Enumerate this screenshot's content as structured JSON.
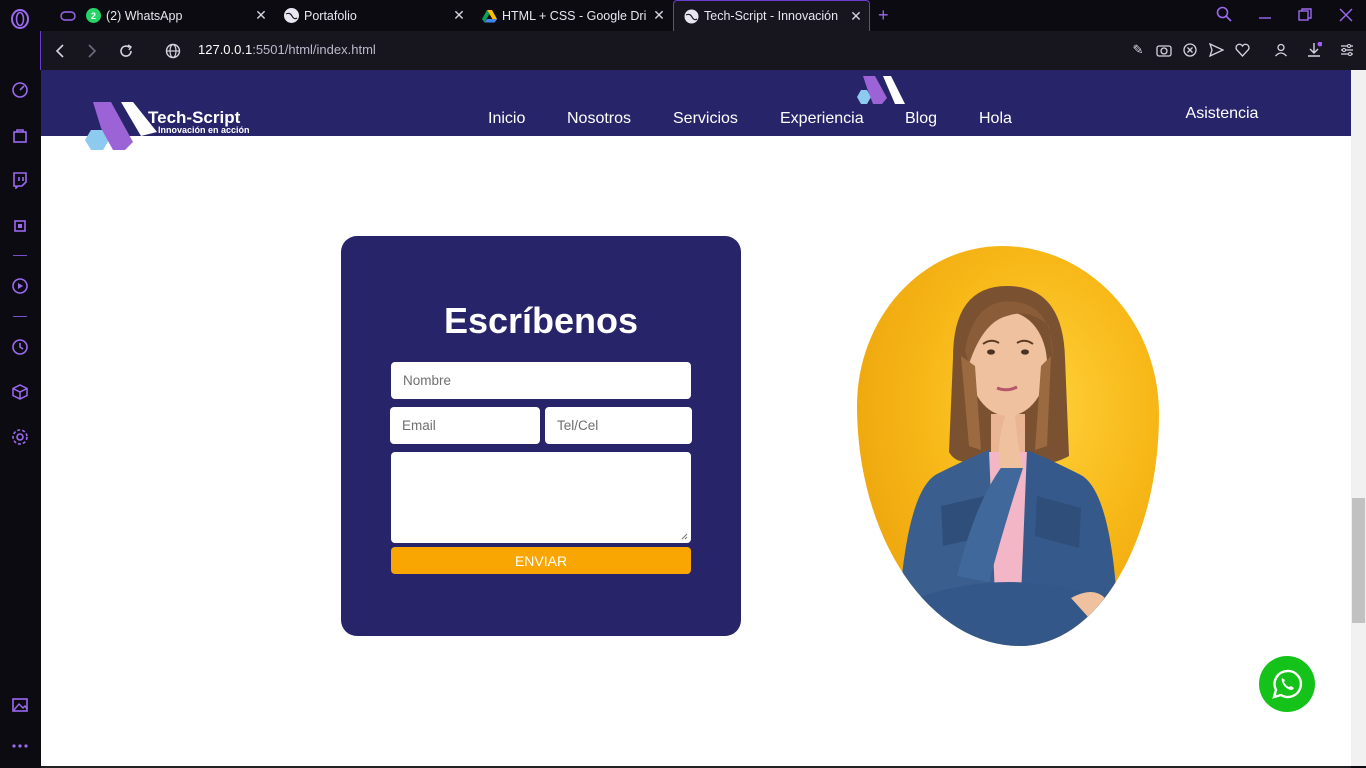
{
  "browser": {
    "tabs": [
      {
        "title": "(2) WhatsApp",
        "badge": "2",
        "active": false
      },
      {
        "title": "Portafolio",
        "active": false
      },
      {
        "title": "HTML + CSS - Google Drive",
        "active": false
      },
      {
        "title": "Tech-Script - Innovación",
        "active": true
      }
    ],
    "url_host": "127.0.0.1",
    "url_rest": ":5501/html/index.html"
  },
  "site": {
    "brand": "Tech-Script",
    "tagline": "Innovación en acción",
    "nav": [
      "Inicio",
      "Nosotros",
      "Servicios",
      "Experiencia",
      "Blog",
      "Hola"
    ],
    "assist_label": "Asistencia"
  },
  "form": {
    "title": "Escríbenos",
    "name_placeholder": "Nombre",
    "email_placeholder": "Email",
    "phone_placeholder": "Tel/Cel",
    "message_placeholder": "",
    "submit_label": "ENVIAR"
  },
  "colors": {
    "brand_navy": "#28246a",
    "accent_orange": "#f9a602",
    "whatsapp_green": "#14c21a",
    "browser_accent": "#6b3ccf"
  },
  "icons": {
    "float_button": "whatsapp-icon",
    "photo": "thinking-woman-photo"
  }
}
